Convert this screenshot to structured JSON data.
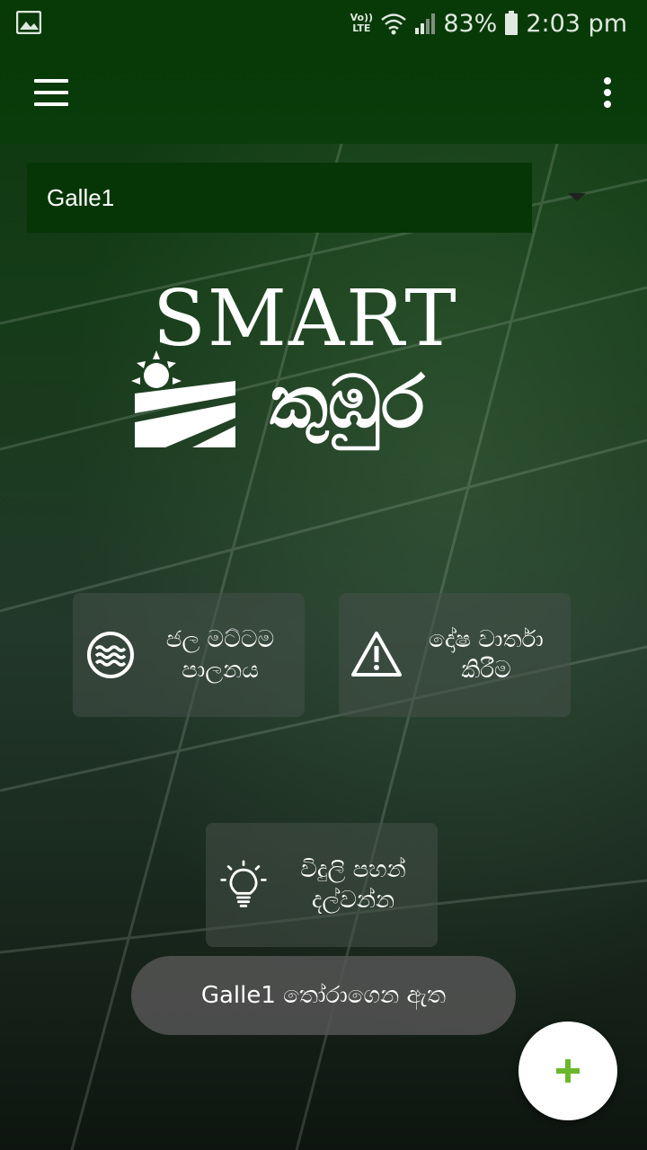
{
  "status_bar": {
    "network": "Vo)) LTE",
    "battery": "83%",
    "time": "2:03 pm"
  },
  "toolbar": {
    "menu_icon": "hamburger-icon",
    "more_icon": "kebab-icon"
  },
  "location_select": {
    "selected": "Galle1"
  },
  "logo": {
    "text": "SMART",
    "script": "කුඹුර"
  },
  "tiles": [
    {
      "label": "ජල මට්ටම\nපාලනය",
      "icon": "water-level-icon"
    },
    {
      "label": "දෝෂ වාර්තා\nකිරීම",
      "icon": "warning-icon"
    },
    {
      "label": "විදුලි පහන්\nදල්වන්න",
      "icon": "light-bulb-icon"
    }
  ],
  "toast": {
    "message": "Galle1 තෝරාගෙන ඇත"
  },
  "fab": {
    "icon": "plus-icon",
    "color": "#6ab82b"
  }
}
